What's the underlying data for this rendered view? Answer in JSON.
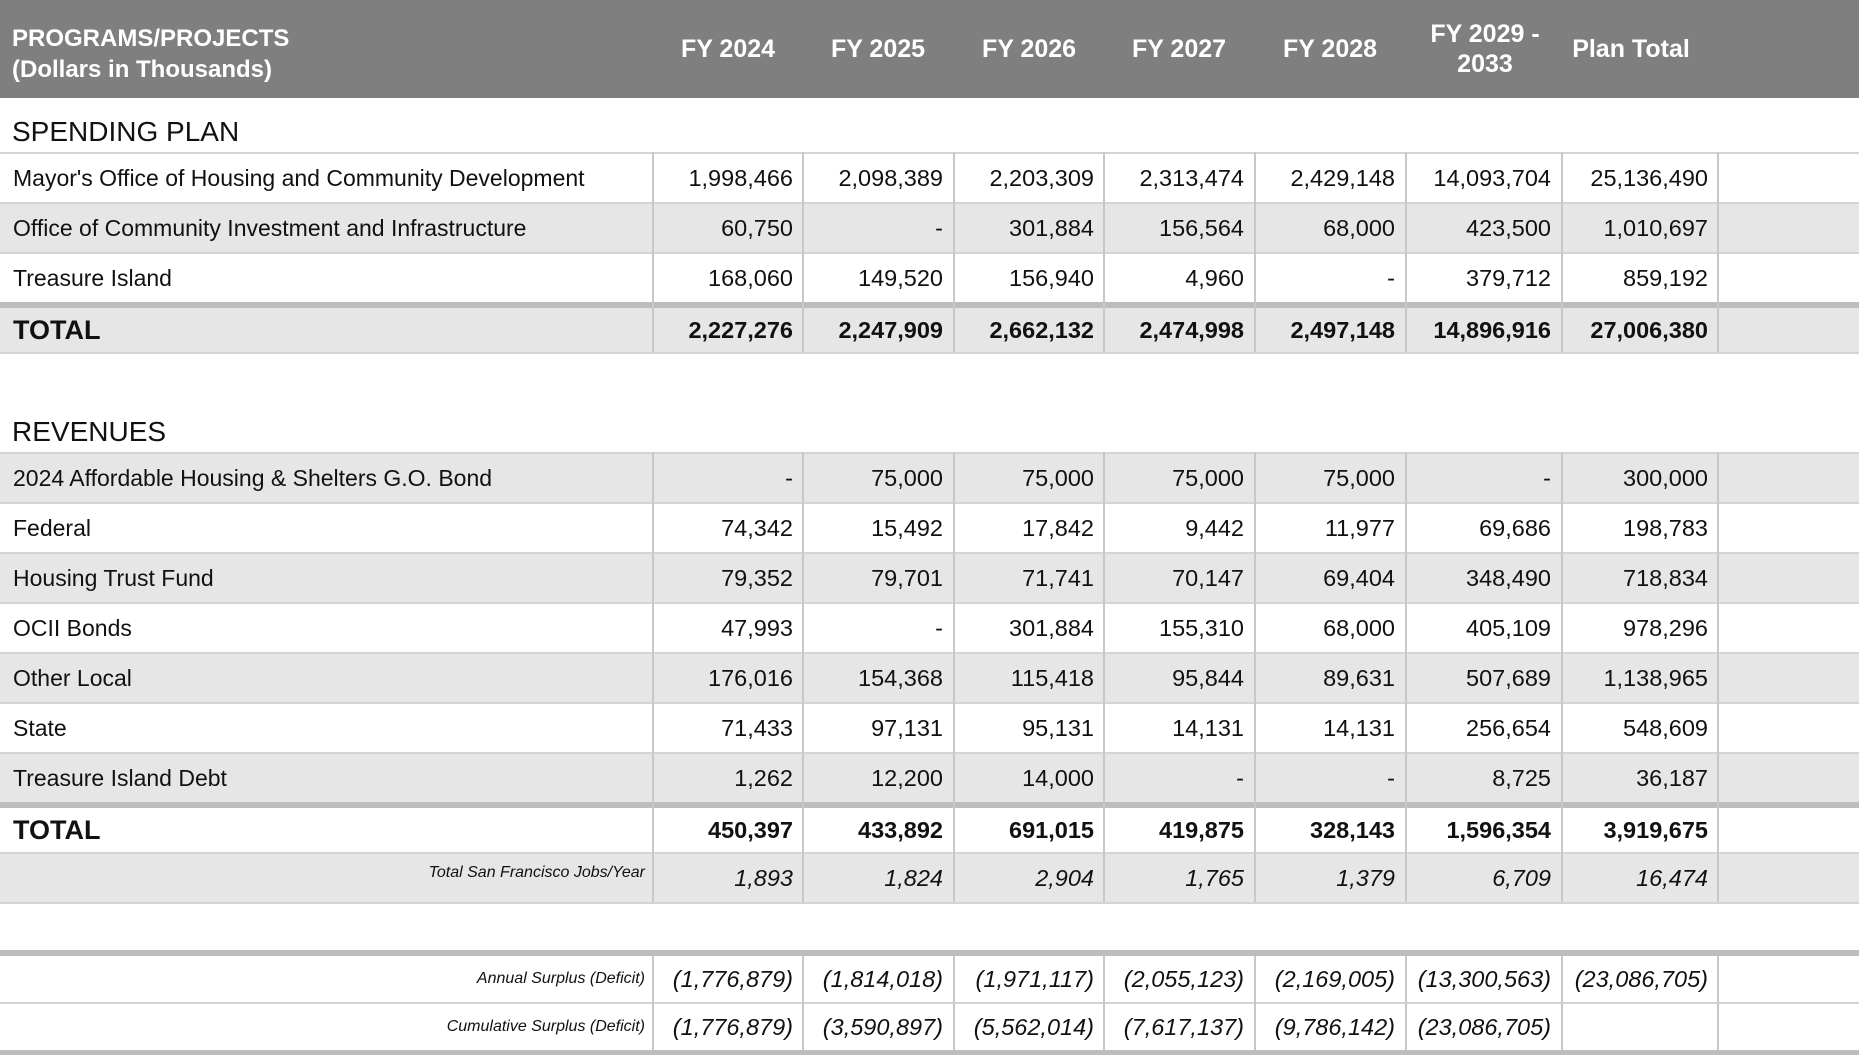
{
  "header": {
    "label_line1": "PROGRAMS/PROJECTS",
    "label_line2": "(Dollars in Thousands)",
    "columns": [
      "FY 2024",
      "FY 2025",
      "FY 2026",
      "FY 2027",
      "FY 2028",
      "FY 2029 -\n2033",
      "Plan Total"
    ]
  },
  "spending": {
    "title": "SPENDING PLAN",
    "rows": [
      {
        "name": "Mayor's Office of Housing and Community Development",
        "values": [
          "1,998,466",
          "2,098,389",
          "2,203,309",
          "2,313,474",
          "2,429,148",
          "14,093,704",
          "25,136,490"
        ]
      },
      {
        "name": "Office of Community Investment and Infrastructure",
        "values": [
          "60,750",
          "-",
          "301,884",
          "156,564",
          "68,000",
          "423,500",
          "1,010,697"
        ]
      },
      {
        "name": "Treasure Island",
        "values": [
          "168,060",
          "149,520",
          "156,940",
          "4,960",
          "-",
          "379,712",
          "859,192"
        ]
      }
    ],
    "total": {
      "name": "TOTAL",
      "values": [
        "2,227,276",
        "2,247,909",
        "2,662,132",
        "2,474,998",
        "2,497,148",
        "14,896,916",
        "27,006,380"
      ]
    }
  },
  "revenues": {
    "title": "REVENUES",
    "rows": [
      {
        "name": "2024 Affordable Housing & Shelters G.O. Bond",
        "values": [
          "-",
          "75,000",
          "75,000",
          "75,000",
          "75,000",
          "-",
          "300,000"
        ]
      },
      {
        "name": "Federal",
        "values": [
          "74,342",
          "15,492",
          "17,842",
          "9,442",
          "11,977",
          "69,686",
          "198,783"
        ]
      },
      {
        "name": "Housing Trust Fund",
        "values": [
          "79,352",
          "79,701",
          "71,741",
          "70,147",
          "69,404",
          "348,490",
          "718,834"
        ]
      },
      {
        "name": "OCII Bonds",
        "values": [
          "47,993",
          "-",
          "301,884",
          "155,310",
          "68,000",
          "405,109",
          "978,296"
        ]
      },
      {
        "name": "Other Local",
        "values": [
          "176,016",
          "154,368",
          "115,418",
          "95,844",
          "89,631",
          "507,689",
          "1,138,965"
        ]
      },
      {
        "name": "State",
        "values": [
          "71,433",
          "97,131",
          "95,131",
          "14,131",
          "14,131",
          "256,654",
          "548,609"
        ]
      },
      {
        "name": "Treasure Island Debt",
        "values": [
          "1,262",
          "12,200",
          "14,000",
          "-",
          "-",
          "8,725",
          "36,187"
        ]
      }
    ],
    "total": {
      "name": "TOTAL",
      "values": [
        "450,397",
        "433,892",
        "691,015",
        "419,875",
        "328,143",
        "1,596,354",
        "3,919,675"
      ]
    },
    "jobs": {
      "name": "Total San Francisco Jobs/Year",
      "values": [
        "1,893",
        "1,824",
        "2,904",
        "1,765",
        "1,379",
        "6,709",
        "16,474"
      ]
    }
  },
  "surplus": {
    "annual": {
      "name": "Annual Surplus (Deficit)",
      "values": [
        "(1,776,879)",
        "(1,814,018)",
        "(1,971,117)",
        "(2,055,123)",
        "(2,169,005)",
        "(13,300,563)",
        "(23,086,705)"
      ]
    },
    "cumulative": {
      "name": "Cumulative Surplus (Deficit)",
      "values": [
        "(1,776,879)",
        "(3,590,897)",
        "(5,562,014)",
        "(7,617,137)",
        "(9,786,142)",
        "(23,086,705)",
        ""
      ]
    }
  }
}
